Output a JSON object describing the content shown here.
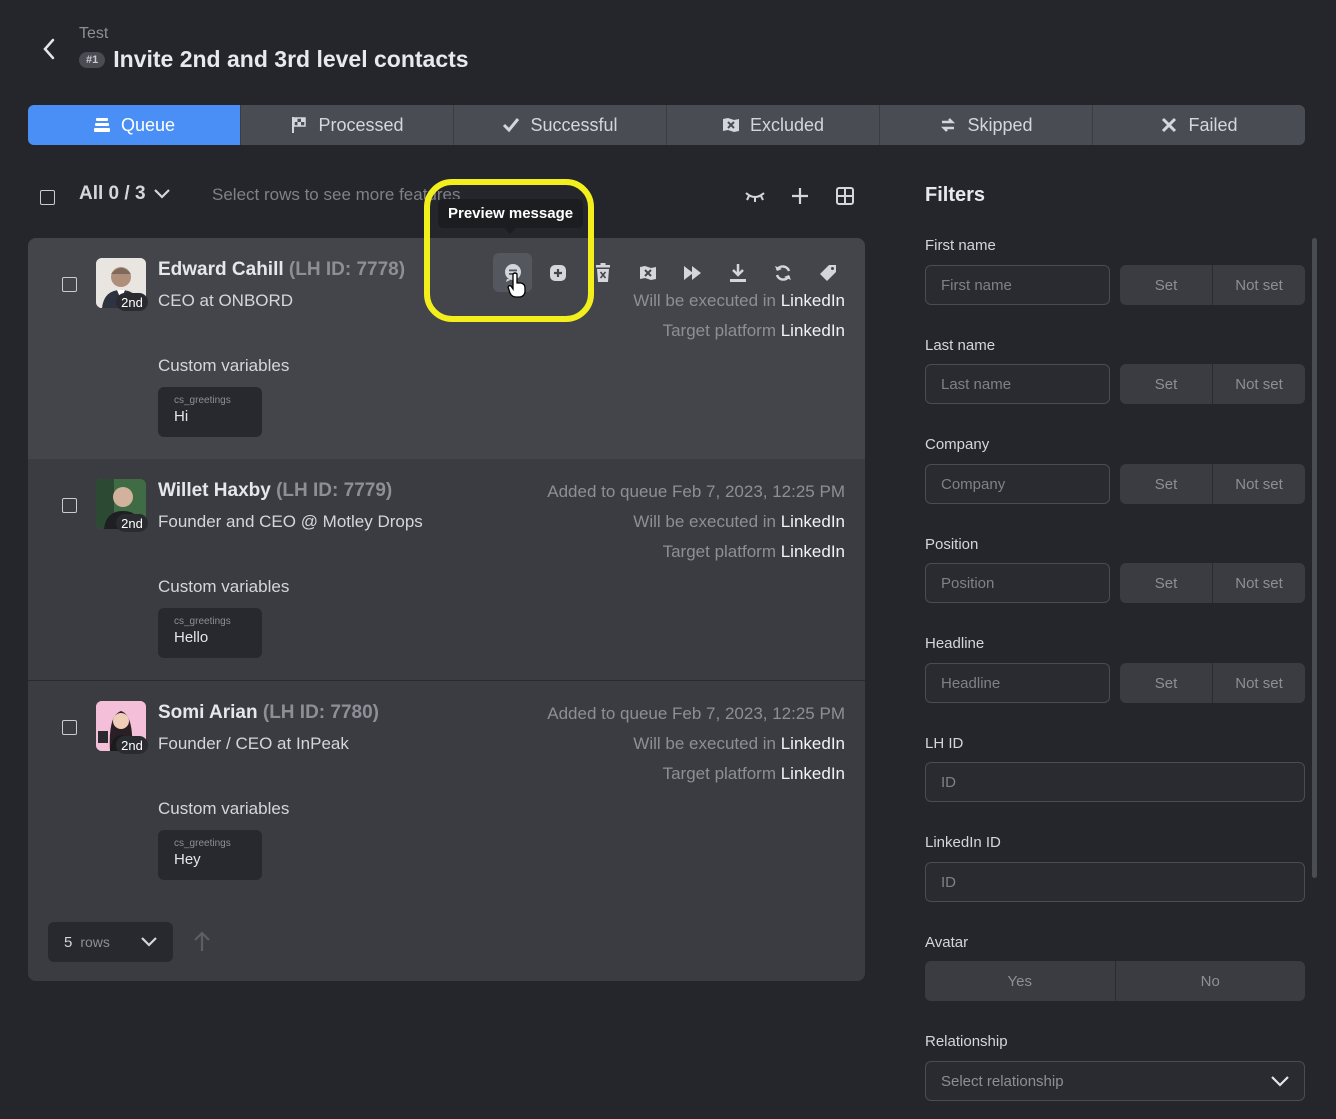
{
  "header": {
    "breadcrumb": "Test",
    "badge": "#1",
    "title": "Invite 2nd and 3rd level contacts"
  },
  "tabs": [
    {
      "label": "Queue",
      "icon": "queue-icon",
      "active": true
    },
    {
      "label": "Processed",
      "icon": "flag-icon"
    },
    {
      "label": "Successful",
      "icon": "check-icon"
    },
    {
      "label": "Excluded",
      "icon": "exclude-icon"
    },
    {
      "label": "Skipped",
      "icon": "skip-icon"
    },
    {
      "label": "Failed",
      "icon": "x-icon"
    }
  ],
  "toolbar": {
    "all_label": "All 0 / 3",
    "hint": "Select rows to see more features"
  },
  "tooltip": "Preview message",
  "people": [
    {
      "name": "Edward Cahill",
      "lh_id": "(LH ID: 7778)",
      "degree": "2nd",
      "position": "CEO at ONBORD",
      "added": "",
      "executed_prefix": "Will be executed in",
      "executed_value": "LinkedIn",
      "target_prefix": "Target platform",
      "target_value": "LinkedIn",
      "cv_label": "Custom variables",
      "cv_key": "cs_greetings",
      "cv_value": "Hi"
    },
    {
      "name": "Willet Haxby",
      "lh_id": "(LH ID: 7779)",
      "degree": "2nd",
      "position": "Founder and CEO @ Motley Drops",
      "added": "Added to queue Feb 7, 2023, 12:25 PM",
      "executed_prefix": "Will be executed in",
      "executed_value": "LinkedIn",
      "target_prefix": "Target platform",
      "target_value": "LinkedIn",
      "cv_label": "Custom variables",
      "cv_key": "cs_greetings",
      "cv_value": "Hello"
    },
    {
      "name": "Somi Arian",
      "lh_id": "(LH ID: 7780)",
      "degree": "2nd",
      "position": "Founder / CEO at InPeak",
      "added": "Added to queue Feb 7, 2023, 12:25 PM",
      "executed_prefix": "Will be executed in",
      "executed_value": "LinkedIn",
      "target_prefix": "Target platform",
      "target_value": "LinkedIn",
      "cv_label": "Custom variables",
      "cv_key": "cs_greetings",
      "cv_value": "Hey"
    }
  ],
  "pager": {
    "rows_value": "5",
    "rows_label": "rows"
  },
  "filters": {
    "title": "Filters",
    "first_name": {
      "label": "First name",
      "placeholder": "First name"
    },
    "last_name": {
      "label": "Last name",
      "placeholder": "Last name"
    },
    "company": {
      "label": "Company",
      "placeholder": "Company"
    },
    "position": {
      "label": "Position",
      "placeholder": "Position"
    },
    "headline": {
      "label": "Headline",
      "placeholder": "Headline"
    },
    "set": "Set",
    "not_set": "Not set",
    "lh_id": {
      "label": "LH ID",
      "placeholder": "ID"
    },
    "linkedin_id": {
      "label": "LinkedIn ID",
      "placeholder": "ID"
    },
    "avatar": {
      "label": "Avatar",
      "yes": "Yes",
      "no": "No"
    },
    "relationship": {
      "label": "Relationship",
      "placeholder": "Select relationship"
    }
  },
  "colors": {
    "accent": "#4a8ff5",
    "highlight_ring": "#f2ef1c",
    "background": "#25262b"
  }
}
